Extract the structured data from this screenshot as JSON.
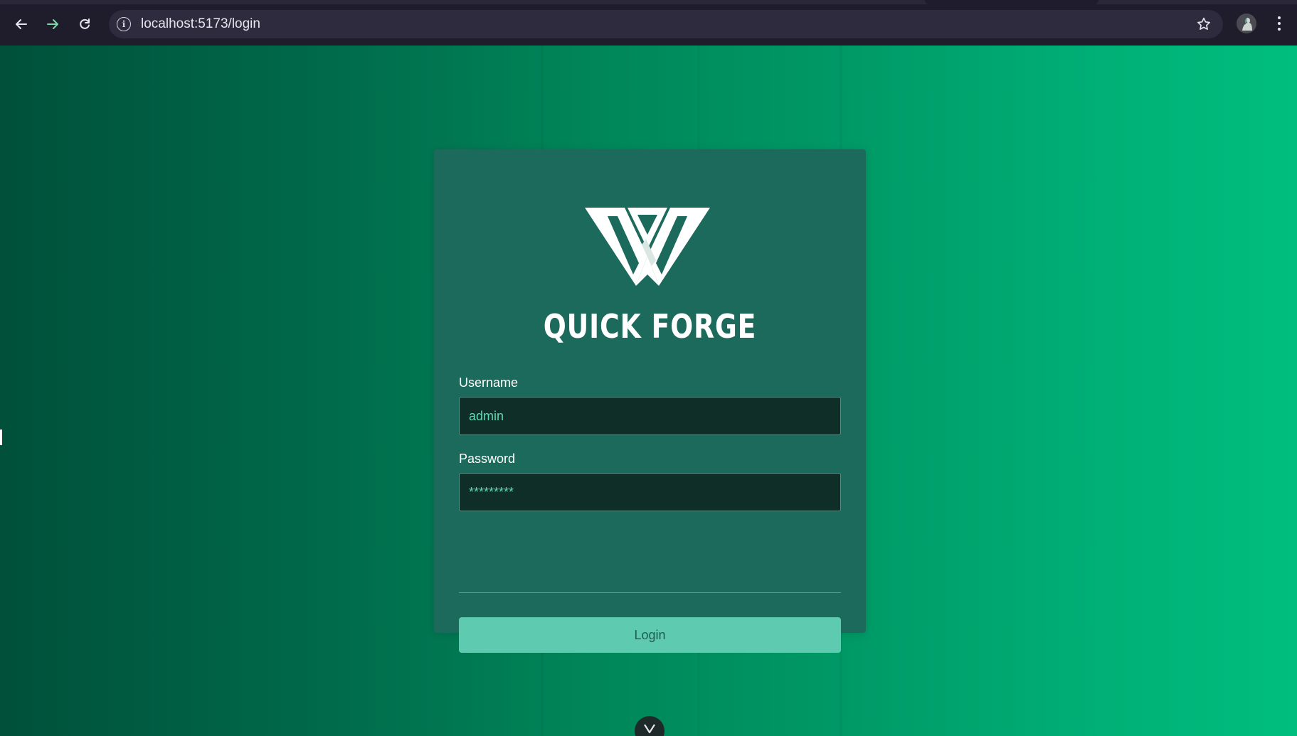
{
  "browser": {
    "url": "localhost:5173/login",
    "back_icon": "arrow-left-icon",
    "forward_icon": "arrow-right-icon",
    "reload_icon": "reload-icon",
    "site_info_icon": "info-icon",
    "bookmark_icon": "star-icon",
    "profile_icon": "avatar",
    "menu_icon": "kebab-menu-icon"
  },
  "login": {
    "brand": "QUICK FORGE",
    "logo_icon": "quick-forge-logo",
    "username_label": "Username",
    "username_value": "admin",
    "password_label": "Password",
    "password_value": "*********",
    "submit_label": "Login"
  },
  "colors": {
    "page_gradient_start": "#00503a",
    "page_gradient_end": "#00be7e",
    "card_bg": "#1c6a5c",
    "input_bg": "#0f2e27",
    "input_text": "#5fd9b4",
    "button_bg": "#5ecab0",
    "button_text": "#215d4f"
  }
}
